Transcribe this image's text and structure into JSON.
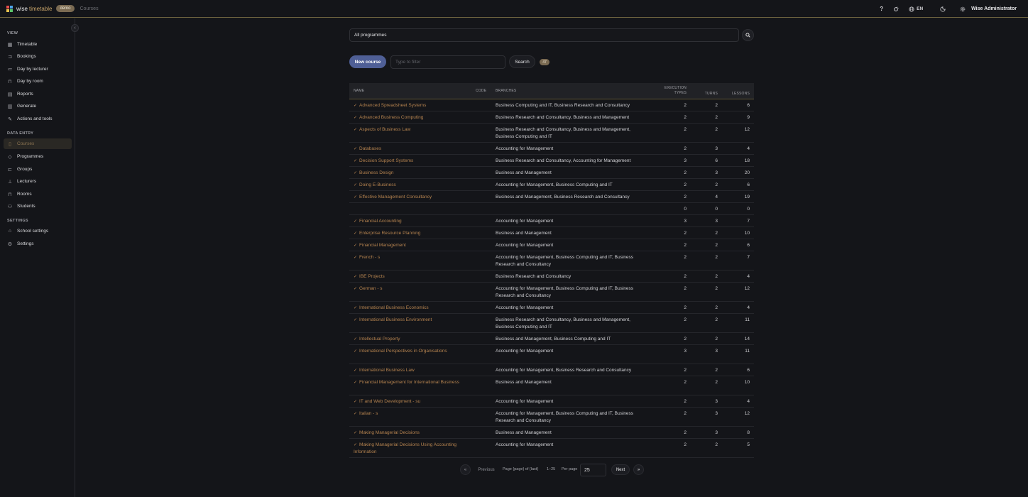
{
  "brand": {
    "name_a": "wise",
    "name_b": "timetable",
    "badge": "demo",
    "logo_colors": [
      "#e84e4e",
      "#4ea3e8",
      "#e8c34e",
      "#5bc46a"
    ]
  },
  "breadcrumb": "Courses",
  "topbar": {
    "help_icon": "?",
    "language": "EN",
    "user": "Wise Administrator"
  },
  "sidebar": {
    "sections": [
      {
        "title": "VIEW",
        "items": [
          {
            "label": "Timetable",
            "icon": "grid-icon"
          },
          {
            "label": "Bookings",
            "icon": "bookmark-icon"
          },
          {
            "label": "Day by lecturer",
            "icon": "user-list-icon"
          },
          {
            "label": "Day by room",
            "icon": "door-icon"
          },
          {
            "label": "Reports",
            "icon": "report-icon"
          },
          {
            "label": "Generate",
            "icon": "calendar-icon"
          },
          {
            "label": "Actions and tools",
            "icon": "wrench-icon"
          }
        ]
      },
      {
        "title": "DATA ENTRY",
        "items": [
          {
            "label": "Courses",
            "icon": "book-icon",
            "active": true
          },
          {
            "label": "Programmes",
            "icon": "graduation-cap-icon"
          },
          {
            "label": "Groups",
            "icon": "group-icon"
          },
          {
            "label": "Lecturers",
            "icon": "lecturer-icon"
          },
          {
            "label": "Rooms",
            "icon": "room-icon"
          },
          {
            "label": "Students",
            "icon": "students-icon"
          }
        ]
      },
      {
        "title": "SETTINGS",
        "items": [
          {
            "label": "School settings",
            "icon": "school-icon"
          },
          {
            "label": "Settings",
            "icon": "gear-icon"
          }
        ]
      }
    ]
  },
  "filters": {
    "programme": "All programmes",
    "new_course": "New course",
    "filter_placeholder": "Type to filter",
    "search": "Search",
    "count": "47"
  },
  "table": {
    "headers": {
      "name": "NAME",
      "code": "CODE",
      "branches": "BRANCHES",
      "exec_1": "EXECUTION",
      "exec_2": "TYPES",
      "turns": "TURNS",
      "lessons": "LESSONS"
    },
    "rows": [
      {
        "name": "Advanced Spreadsheet Systems",
        "branches": "Business Computing and IT, Business Research and Consultancy",
        "exec": "2",
        "turns": "2",
        "lessons": "6"
      },
      {
        "name": "Advanced Business Computing",
        "branches": "Business Research and Consultancy, Business and Management",
        "exec": "2",
        "turns": "2",
        "lessons": "9"
      },
      {
        "name": "Aspects of Business Law",
        "branches": "Business Research and Consultancy, Business and Management, Business Computing and IT",
        "exec": "2",
        "turns": "2",
        "lessons": "12"
      },
      {
        "name": "Databases",
        "branches": "Accounting for Management",
        "exec": "2",
        "turns": "3",
        "lessons": "4"
      },
      {
        "name": "Decision Support Systems",
        "branches": "Business Research and Consultancy, Accounting for Management",
        "exec": "3",
        "turns": "6",
        "lessons": "18"
      },
      {
        "name": "Business Design",
        "branches": "Business and Management",
        "exec": "2",
        "turns": "3",
        "lessons": "20"
      },
      {
        "name": "Doing E-Business",
        "branches": "Accounting for Management, Business Computing and IT",
        "exec": "2",
        "turns": "2",
        "lessons": "6"
      },
      {
        "name": "Effective Management Consultancy",
        "branches": "Business and Management, Business Research and Consultancy",
        "exec": "2",
        "turns": "4",
        "lessons": "19"
      },
      {
        "name": "",
        "branches": "",
        "exec": "0",
        "turns": "0",
        "lessons": "0"
      },
      {
        "name": "Financial Accounting",
        "branches": "Accounting for Management",
        "exec": "3",
        "turns": "3",
        "lessons": "7"
      },
      {
        "name": "Enterprise Resource Planning",
        "branches": "Business and Management",
        "exec": "2",
        "turns": "2",
        "lessons": "10"
      },
      {
        "name": "Financial Management",
        "branches": "Accounting for Management",
        "exec": "2",
        "turns": "2",
        "lessons": "6"
      },
      {
        "name": "French - s",
        "branches": "Accounting for Management, Business Computing and IT, Business Research and Consultancy",
        "exec": "2",
        "turns": "2",
        "lessons": "7"
      },
      {
        "name": "IBE Projects",
        "branches": "Business Research and Consultancy",
        "exec": "2",
        "turns": "2",
        "lessons": "4"
      },
      {
        "name": "German - s",
        "branches": "Accounting for Management, Business Computing and IT, Business Research and Consultancy",
        "exec": "2",
        "turns": "2",
        "lessons": "12"
      },
      {
        "name": "International Business Economics",
        "branches": "Accounting for Management",
        "exec": "2",
        "turns": "2",
        "lessons": "4"
      },
      {
        "name": "International Business Environment",
        "branches": "Business Research and Consultancy, Business and Management, Business Computing and IT",
        "exec": "2",
        "turns": "2",
        "lessons": "11"
      },
      {
        "name": "Intellectual Property",
        "branches": "Business and Management, Business Computing and IT",
        "exec": "2",
        "turns": "2",
        "lessons": "14"
      },
      {
        "name": "International Perspectives in Organisations",
        "branches": "Accounting for Management",
        "exec": "3",
        "turns": "3",
        "lessons": "11"
      },
      {
        "name": "International Business Law",
        "branches": "Accounting for Management, Business Research and Consultancy",
        "exec": "2",
        "turns": "2",
        "lessons": "6"
      },
      {
        "name": "Financial Management for International Business",
        "branches": "Business and Management",
        "exec": "2",
        "turns": "2",
        "lessons": "10"
      },
      {
        "name": "IT and Web Development - su",
        "branches": "Accounting for Management",
        "exec": "2",
        "turns": "3",
        "lessons": "4"
      },
      {
        "name": "Italian - s",
        "branches": "Accounting for Management, Business Computing and IT, Business Research and Consultancy",
        "exec": "2",
        "turns": "3",
        "lessons": "12"
      },
      {
        "name": "Making Managerial Decisions",
        "branches": "Business and Management",
        "exec": "2",
        "turns": "3",
        "lessons": "8"
      },
      {
        "name": "Making Managerial Decisions Using Accounting Information",
        "branches": "Accounting for Management",
        "exec": "2",
        "turns": "2",
        "lessons": "5"
      }
    ]
  },
  "pagination": {
    "first": "«",
    "previous": "Previous",
    "page_info": "Page {page} of {last}",
    "range": "1–25",
    "per_page_label": "Per page",
    "per_page": "25",
    "next": "Next",
    "last": "»"
  }
}
